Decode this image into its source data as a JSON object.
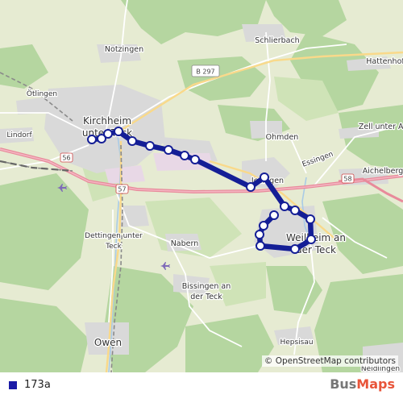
{
  "map": {
    "places": {
      "notzingen": "Notzingen",
      "schlierbach": "Schlierbach",
      "hattenhof": "Hattenhof",
      "otlingen": "Ötlingen",
      "kirchheim_1": "Kirchheim",
      "kirchheim_2": "unter Teck",
      "lindorf": "Lindorf",
      "ohmden": "Ohmden",
      "zell_1": "Zell unter Ai",
      "aichelberg": "Aichelberg",
      "essingen": "Essingen",
      "jesingen": "Jesingen",
      "weilheim_1": "Weilheim an",
      "weilheim_2": "der Teck",
      "dettingen_1": "Dettingen unter",
      "dettingen_2": "Teck",
      "nabern": "Nabern",
      "bissingen_1": "Bissingen an",
      "bissingen_2": "der Teck",
      "owen": "Owen",
      "hepsisau": "Hepsisau",
      "neidlingen": "Neidlingen"
    },
    "roads": {
      "b297": "B 297",
      "a8_west": "56",
      "a8_mid": "57",
      "a8_east": "58"
    },
    "route": {
      "color": "#141e96",
      "stop_count": 20
    }
  },
  "attribution": {
    "icon": "copyright-icon",
    "text": "© OpenStreetMap contributors"
  },
  "legend": {
    "route_label": "173a",
    "route_color": "#1a1aa6"
  },
  "brand": {
    "part1": "Bus",
    "part2": "Maps"
  }
}
